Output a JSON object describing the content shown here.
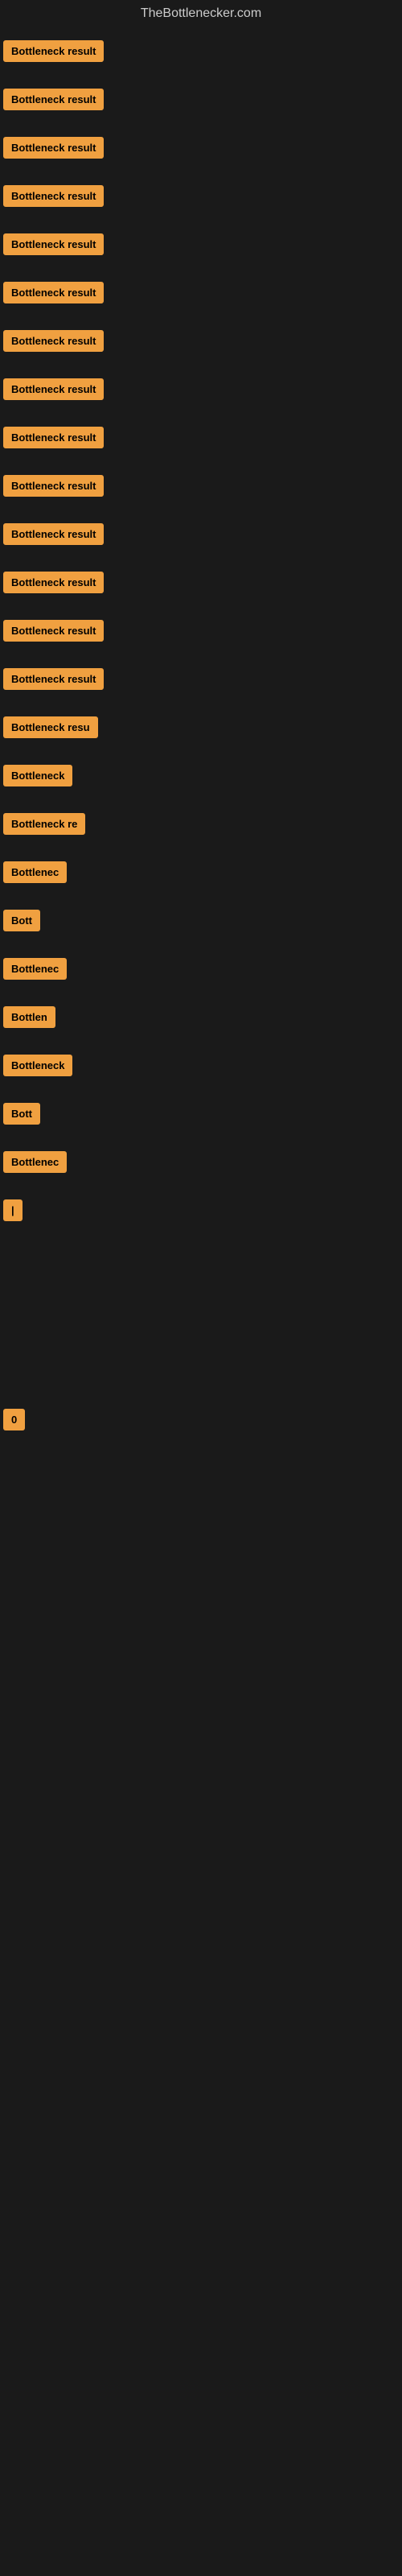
{
  "site": {
    "title": "TheBottlenecker.com"
  },
  "items": [
    {
      "label": "Bottleneck result",
      "width": 140
    },
    {
      "label": "Bottleneck result",
      "width": 140
    },
    {
      "label": "Bottleneck result",
      "width": 140
    },
    {
      "label": "Bottleneck result",
      "width": 140
    },
    {
      "label": "Bottleneck result",
      "width": 140
    },
    {
      "label": "Bottleneck result",
      "width": 140
    },
    {
      "label": "Bottleneck result",
      "width": 140
    },
    {
      "label": "Bottleneck result",
      "width": 140
    },
    {
      "label": "Bottleneck result",
      "width": 140
    },
    {
      "label": "Bottleneck result",
      "width": 140
    },
    {
      "label": "Bottleneck result",
      "width": 140
    },
    {
      "label": "Bottleneck result",
      "width": 140
    },
    {
      "label": "Bottleneck result",
      "width": 140
    },
    {
      "label": "Bottleneck result",
      "width": 140
    },
    {
      "label": "Bottleneck resu",
      "width": 120
    },
    {
      "label": "Bottleneck",
      "width": 90
    },
    {
      "label": "Bottleneck re",
      "width": 105
    },
    {
      "label": "Bottlenec",
      "width": 80
    },
    {
      "label": "Bott",
      "width": 50
    },
    {
      "label": "Bottlenec",
      "width": 80
    },
    {
      "label": "Bottlen",
      "width": 70
    },
    {
      "label": "Bottleneck",
      "width": 90
    },
    {
      "label": "Bott",
      "width": 50
    },
    {
      "label": "Bottlenec",
      "width": 80
    },
    {
      "label": "|",
      "width": 10
    },
    {
      "label": "",
      "width": 0
    },
    {
      "label": "",
      "width": 0
    },
    {
      "label": "",
      "width": 0
    },
    {
      "label": "",
      "width": 0
    },
    {
      "label": "",
      "width": 0
    },
    {
      "label": "0",
      "width": 15
    },
    {
      "label": "",
      "width": 0
    },
    {
      "label": "",
      "width": 0
    },
    {
      "label": "",
      "width": 0
    },
    {
      "label": "",
      "width": 0
    },
    {
      "label": "",
      "width": 0
    }
  ]
}
